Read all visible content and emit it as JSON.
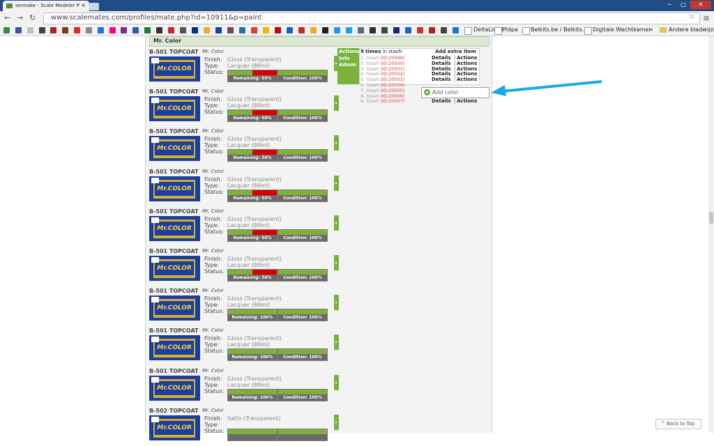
{
  "browser": {
    "tab_title": "sennake - Scale Modeler P",
    "url": "www.scalemates.com/profiles/mate.php?id=10911&p=paint",
    "nav": {
      "back": "←",
      "forward": "→",
      "reload": "↻"
    },
    "window_controls": [
      "─",
      "□",
      "✕"
    ],
    "bookmarks": [
      {
        "label": "DeltaLloyd",
        "type": "page"
      },
      {
        "label": "Pidpa",
        "type": "page"
      },
      {
        "label": "Belkits.be / Belkits.c...",
        "type": "page"
      },
      {
        "label": "Digitale Wachtkamer",
        "type": "page"
      },
      {
        "label": "»",
        "type": "more"
      },
      {
        "label": "Andere bladwijzers",
        "type": "folder"
      }
    ]
  },
  "page": {
    "section_title": "Mr. Color",
    "paints": [
      {
        "code": "B-501 TOPCOAT",
        "brand": "Mr. Color",
        "finish": "Gloss (Transparent)",
        "type": "Lacquer (88ml)",
        "remaining_label": "Remaining: 50%",
        "remaining": 50,
        "condition_label": "Condition: 100%",
        "condition": 100
      },
      {
        "code": "B-501 TOPCOAT",
        "brand": "Mr. Color",
        "finish": "Gloss (Transparent)",
        "type": "Lacquer (88ml)",
        "remaining_label": "Remaining: 50%",
        "remaining": 50,
        "condition_label": "Condition: 100%",
        "condition": 100
      },
      {
        "code": "B-501 TOPCOAT",
        "brand": "Mr. Color",
        "finish": "Gloss (Transparent)",
        "type": "Lacquer (88ml)",
        "remaining_label": "Remaining: 50%",
        "remaining": 50,
        "condition_label": "Condition: 100%",
        "condition": 100
      },
      {
        "code": "B-501 TOPCOAT",
        "brand": "Mr. Color",
        "finish": "Gloss (Transparent)",
        "type": "Lacquer (88ml)",
        "remaining_label": "Remaining: 50%",
        "remaining": 50,
        "condition_label": "Condition: 100%",
        "condition": 100
      },
      {
        "code": "B-501 TOPCOAT",
        "brand": "Mr. Color",
        "finish": "Gloss (Transparent)",
        "type": "Lacquer (88ml)",
        "remaining_label": "Remaining: 50%",
        "remaining": 50,
        "condition_label": "Condition: 100%",
        "condition": 100
      },
      {
        "code": "B-501 TOPCOAT",
        "brand": "Mr. Color",
        "finish": "Gloss (Transparent)",
        "type": "Lacquer (88ml)",
        "remaining_label": "Remaining: 50%",
        "remaining": 50,
        "condition_label": "Condition: 100%",
        "condition": 100
      },
      {
        "code": "B-501 TOPCOAT",
        "brand": "Mr. Color",
        "finish": "Gloss (Transparent)",
        "type": "Lacquer (88ml)",
        "remaining_label": "Remaining: 100%",
        "remaining": 100,
        "condition_label": "Condition: 100%",
        "condition": 100
      },
      {
        "code": "B-501 TOPCOAT",
        "brand": "Mr. Color",
        "finish": "Gloss (Transparent)",
        "type": "Lacquer (88ml)",
        "remaining_label": "Remaining: 100%",
        "remaining": 100,
        "condition_label": "Condition: 100%",
        "condition": 100
      },
      {
        "code": "B-501 TOPCOAT",
        "brand": "Mr. Color",
        "finish": "Gloss (Transparent)",
        "type": "Lacquer (88ml)",
        "remaining_label": "Remaining: 100%",
        "remaining": 100,
        "condition_label": "Condition: 100%",
        "condition": 100
      },
      {
        "code": "B-502 TOPCOAT",
        "brand": "Mr. Color",
        "finish": "Satin (Transparent)",
        "type": "",
        "remaining_label": "",
        "remaining": 100,
        "condition_label": "",
        "condition": 100
      }
    ],
    "labels": {
      "finish": "Finish:",
      "type": "Type:",
      "status": "Status:"
    },
    "thumb_text": "Mr.COLOR",
    "actions_menu": [
      "Actions",
      "Info",
      "Admin"
    ],
    "stash": {
      "count_text": "9 times",
      "suffix_text": "in stash:",
      "add_extra": "Add extra item",
      "details": "Details",
      "actions": "Actions",
      "items": [
        {
          "label": "1. Stash",
          "id": "(ID:20499)"
        },
        {
          "label": "2. Stash",
          "id": "(ID:20500)"
        },
        {
          "label": "3. Stash",
          "id": "(ID:20501)"
        },
        {
          "label": "4. Stash",
          "id": "(ID:20502)"
        },
        {
          "label": "5. Stash",
          "id": "(ID:20503)"
        },
        {
          "label": "6. Stash",
          "id": "(ID:20504)"
        },
        {
          "label": "7. Stash",
          "id": "(ID:20505)"
        },
        {
          "label": "8. Stash",
          "id": "(ID:20506)"
        },
        {
          "label": "9. Stash",
          "id": "(ID:20507)"
        }
      ]
    },
    "add_color": "Add color",
    "back_to_top": "^ Back to Top"
  },
  "colors": {
    "accent_green": "#79b33d",
    "bar_red": "#d80000",
    "thumb_blue": "#1b3ea0",
    "arrow_blue": "#19a9e6"
  }
}
